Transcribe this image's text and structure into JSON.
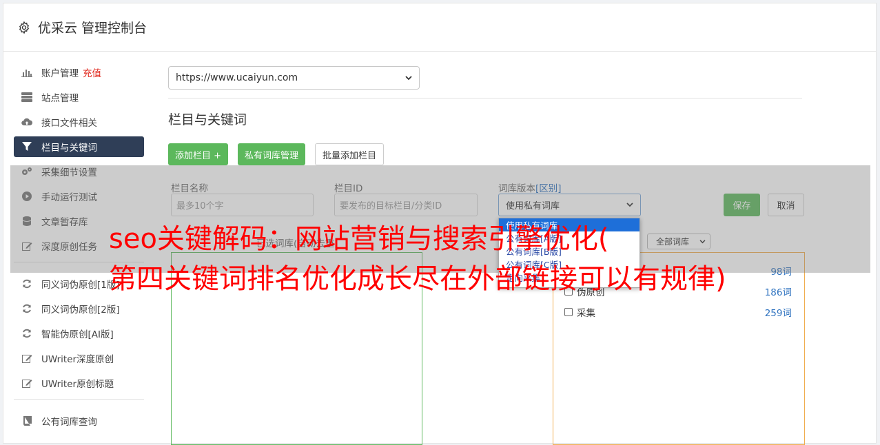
{
  "header": {
    "title": "优采云 管理控制台",
    "icon": "gear-icon"
  },
  "sidebar": {
    "items": [
      {
        "label": "账户管理",
        "accent": "充值",
        "icon": "bar-chart-icon"
      },
      {
        "label": "站点管理",
        "icon": "server-icon"
      },
      {
        "label": "接口文件相关",
        "icon": "cloud-upload-icon"
      },
      {
        "label": "栏目与关键词",
        "icon": "filter-icon",
        "active": true
      },
      {
        "label": "采集细节设置",
        "icon": "cogs-icon"
      },
      {
        "label": "手动运行测试",
        "icon": "play-circle-icon"
      },
      {
        "label": "文章暂存库",
        "icon": "database-icon"
      },
      {
        "label": "深度原创任务",
        "icon": "edit-icon"
      },
      {
        "label": "同义词伪原创[1版]",
        "icon": "refresh-icon"
      },
      {
        "label": "同义词伪原创[2版]",
        "icon": "refresh-icon"
      },
      {
        "label": "智能伪原创[AI版]",
        "icon": "refresh-icon"
      },
      {
        "label": "UWriter深度原创",
        "icon": "edit-icon"
      },
      {
        "label": "UWriter原创标题",
        "icon": "edit-icon"
      },
      {
        "label": "公有词库查询",
        "icon": "book-icon"
      }
    ]
  },
  "main": {
    "site_url": "https://www.ucaiyun.com",
    "section_title": "栏目与关键词",
    "buttons": {
      "add_column": "添加栏目 +",
      "private_lib": "私有词库管理",
      "batch_add": "批量添加栏目"
    },
    "form": {
      "name_label": "栏目名称",
      "name_placeholder": "最多10个字",
      "id_label": "栏目ID",
      "id_placeholder": "要发布的目标栏目/分类ID",
      "version_label": "词库版本",
      "version_link": "[区别]",
      "version_value": "使用私有词库",
      "save": "保存",
      "cancel": "取消"
    },
    "dropdown_options": [
      "使用私有词库",
      "公有词库[A版]",
      "公有词库[B版]",
      "公有词库[C版]",
      "定向采集"
    ],
    "behind_label": "已选词库(自动去重)",
    "filter_value": "全部词库",
    "libraries": [
      {
        "name": "",
        "count": "98词"
      },
      {
        "name": "伪原创",
        "count": "186词"
      },
      {
        "name": "采集",
        "count": "259词"
      }
    ]
  },
  "watermark": {
    "line1": "seo关键解码：网站营销与搜索引擎优化(",
    "line2": "第四关键词排名优化成长尽在外部链接可以有规律)"
  },
  "colors": {
    "accent_green": "#5cb85c",
    "active_nav": "#2f3e57",
    "watermark": "#ff0000",
    "link": "#2f73c0"
  }
}
